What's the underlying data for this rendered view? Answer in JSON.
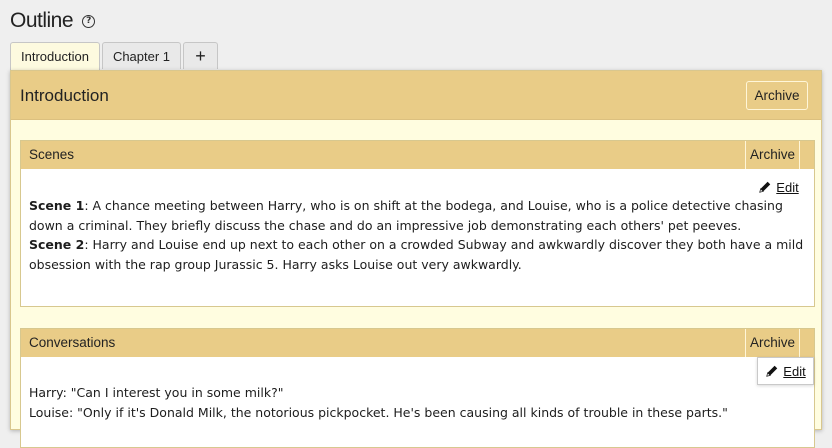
{
  "page": {
    "title": "Outline",
    "help_icon": "help-circle-icon"
  },
  "tabs": [
    {
      "label": "Introduction",
      "active": true
    },
    {
      "label": "Chapter 1",
      "active": false
    },
    {
      "label": "+",
      "active": false
    }
  ],
  "panel": {
    "title": "Introduction",
    "archive_label": "Archive"
  },
  "scenes": {
    "title": "Scenes",
    "archive_label": "Archive",
    "edit_label": "Edit",
    "edit_icon": "pencil-icon",
    "items": [
      {
        "label": "Scene 1",
        "text": ": A chance meeting between Harry, who is on shift at the bodega, and Louise, who is a police detective chasing down a criminal. They briefly discuss the chase and do an impressive job demonstrating each others' pet peeves."
      },
      {
        "label": "Scene 2",
        "text": ": Harry and Louise end up next to each other on a crowded Subway and awkwardly discover they both have a mild obsession with the rap group Jurassic 5. Harry asks Louise out very awkwardly."
      }
    ]
  },
  "conversations": {
    "title": "Conversations",
    "archive_label": "Archive",
    "edit_label": "Edit",
    "edit_icon": "pencil-icon",
    "lines": [
      "Harry: \"Can I interest you in some milk?\"",
      "Louise: \"Only if it's Donald Milk, the notorious pickpocket. He's been causing all kinds of trouble in these parts.\""
    ]
  },
  "colors": {
    "header_gold": "#e9cc87",
    "panel_cream": "#fffde0",
    "page_bg": "#efefef"
  }
}
